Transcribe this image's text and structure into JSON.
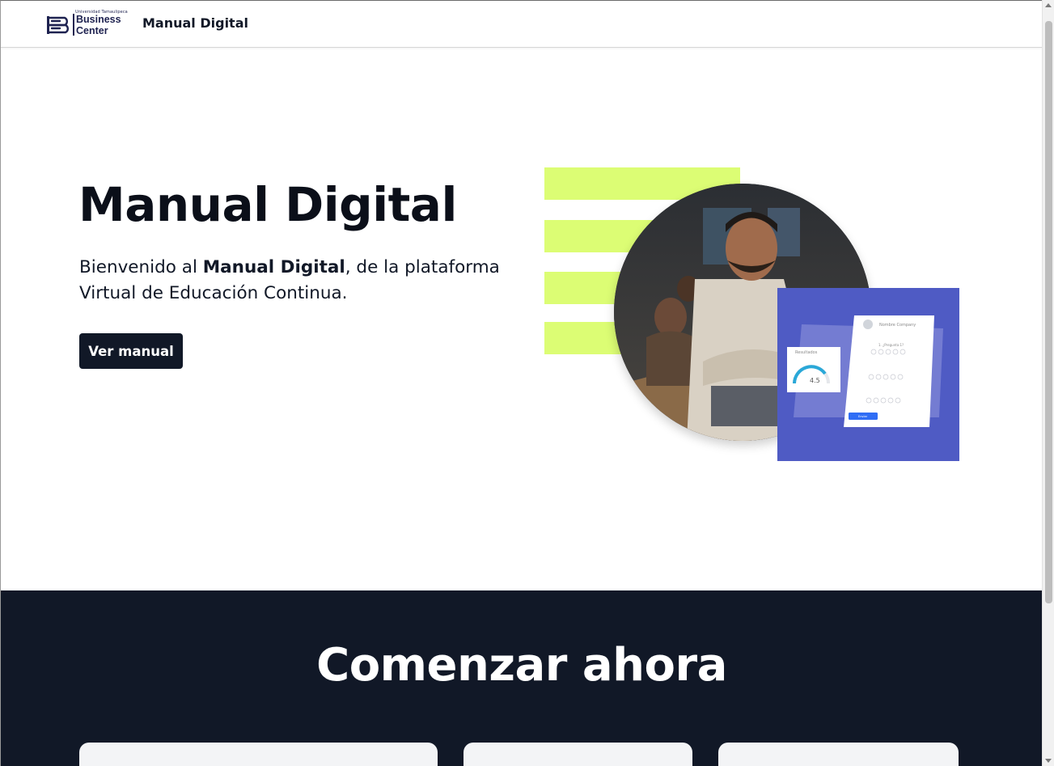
{
  "header": {
    "logo": {
      "small_text": "Universidad Tamaulipeca",
      "line1": "Business",
      "line2": "Center"
    },
    "title": "Manual Digital"
  },
  "hero": {
    "title": "Manual Digital",
    "description_prefix": "Bienvenido al ",
    "description_bold": "Manual Digital",
    "description_suffix": ", de la plataforma Virtual de Educación Continua.",
    "cta_label": "Ver manual",
    "illustration": {
      "mockup_company": "Nombre Company",
      "mockup_result_label": "Resultados",
      "mockup_score": "4.5",
      "mockup_question": "1. ¿Pregunta 1?",
      "mockup_send": "Enviar"
    }
  },
  "start_section": {
    "title": "Comenzar ahora"
  },
  "colors": {
    "accent_lime": "#dcfd74",
    "dark_navy": "#111827",
    "card_blue": "#4f5bc4"
  }
}
